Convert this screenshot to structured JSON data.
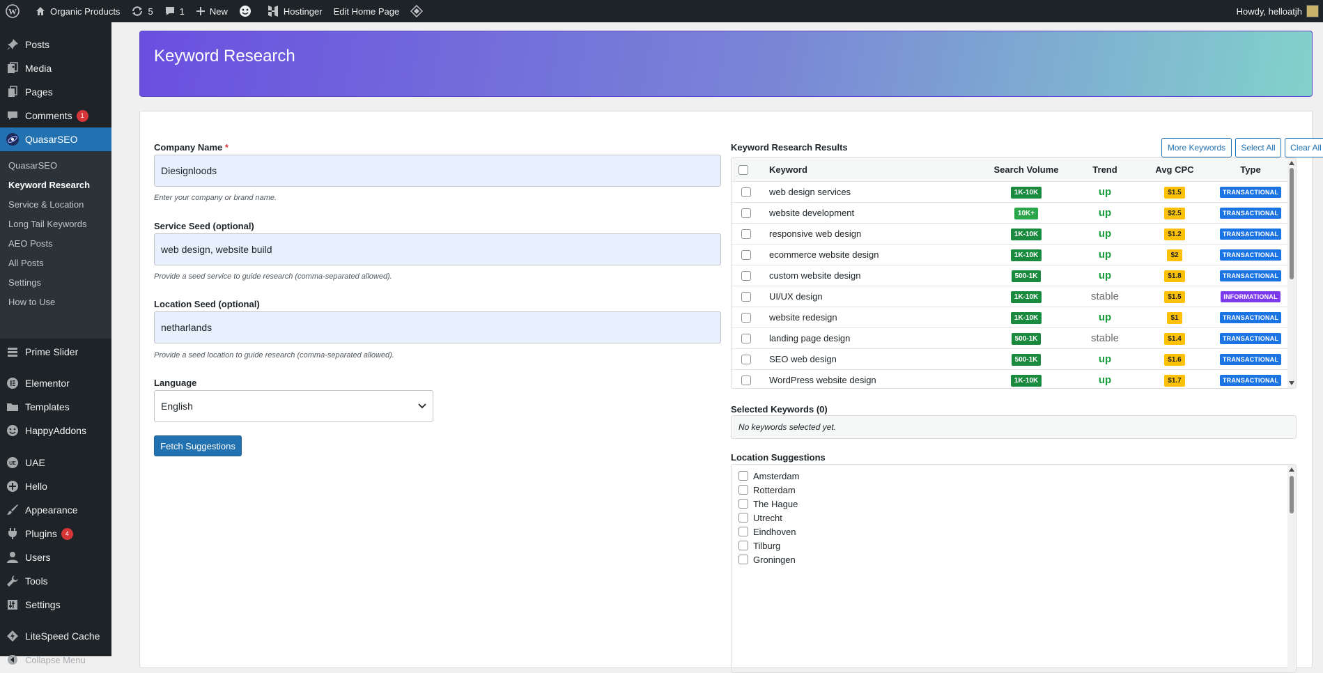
{
  "adminbar": {
    "site_name": "Organic Products",
    "updates_count": "5",
    "comments_count": "1",
    "new_label": "New",
    "hostinger_label": "Hostinger",
    "edit_label": "Edit Home Page",
    "howdy": "Howdy, helloatjh"
  },
  "sidebar": {
    "posts": "Posts",
    "media": "Media",
    "pages": "Pages",
    "comments": "Comments",
    "comments_badge": "1",
    "quasar": "QuasarSEO",
    "sub": [
      "QuasarSEO",
      "Keyword Research",
      "Service & Location",
      "Long Tail Keywords",
      "AEO Posts",
      "All Posts",
      "Settings",
      "How to Use"
    ],
    "prime_slider": "Prime Slider",
    "elementor": "Elementor",
    "templates": "Templates",
    "happyaddons": "HappyAddons",
    "uae": "UAE",
    "hello": "Hello",
    "appearance": "Appearance",
    "plugins": "Plugins",
    "plugins_badge": "4",
    "users": "Users",
    "tools": "Tools",
    "settings": "Settings",
    "litespeed": "LiteSpeed Cache",
    "collapse": "Collapse Menu"
  },
  "page": {
    "title": "Keyword Research"
  },
  "form": {
    "company_label": "Company Name",
    "company_required": "*",
    "company_value": "Diesignloods",
    "company_help": "Enter your company or brand name.",
    "service_label": "Service Seed (optional)",
    "service_value": "web design, website build",
    "service_help": "Provide a seed service to guide research (comma-separated allowed).",
    "location_label": "Location Seed (optional)",
    "location_value": "netharlands",
    "location_help": "Provide a seed location to guide research (comma-separated allowed).",
    "language_label": "Language",
    "language_value": "English",
    "fetch_button": "Fetch Suggestions"
  },
  "results": {
    "title": "Keyword Research Results",
    "more_button": "More Keywords",
    "select_all_button": "Select All",
    "clear_all_button": "Clear All",
    "headers": [
      "Keyword",
      "Search Volume",
      "Trend",
      "Avg CPC",
      "Type"
    ],
    "rows": [
      {
        "keyword": "web design services",
        "volume": "1K-10K",
        "trend": "up",
        "cpc": "$1.5",
        "type": "TRANSACTIONAL"
      },
      {
        "keyword": "website development",
        "volume": "10K+",
        "trend": "up",
        "cpc": "$2.5",
        "type": "TRANSACTIONAL"
      },
      {
        "keyword": "responsive web design",
        "volume": "1K-10K",
        "trend": "up",
        "cpc": "$1.2",
        "type": "TRANSACTIONAL"
      },
      {
        "keyword": "ecommerce website design",
        "volume": "1K-10K",
        "trend": "up",
        "cpc": "$2",
        "type": "TRANSACTIONAL"
      },
      {
        "keyword": "custom website design",
        "volume": "500-1K",
        "trend": "up",
        "cpc": "$1.8",
        "type": "TRANSACTIONAL"
      },
      {
        "keyword": "UI/UX design",
        "volume": "1K-10K",
        "trend": "stable",
        "cpc": "$1.5",
        "type": "INFORMATIONAL"
      },
      {
        "keyword": "website redesign",
        "volume": "1K-10K",
        "trend": "up",
        "cpc": "$1",
        "type": "TRANSACTIONAL"
      },
      {
        "keyword": "landing page design",
        "volume": "500-1K",
        "trend": "stable",
        "cpc": "$1.4",
        "type": "TRANSACTIONAL"
      },
      {
        "keyword": "SEO web design",
        "volume": "500-1K",
        "trend": "up",
        "cpc": "$1.6",
        "type": "TRANSACTIONAL"
      },
      {
        "keyword": "WordPress website design",
        "volume": "1K-10K",
        "trend": "up",
        "cpc": "$1.7",
        "type": "TRANSACTIONAL"
      }
    ]
  },
  "selected": {
    "title": "Selected Keywords (0)",
    "empty": "No keywords selected yet."
  },
  "locations": {
    "title": "Location Suggestions",
    "items": [
      "Amsterdam",
      "Rotterdam",
      "The Hague",
      "Utrecht",
      "Eindhoven",
      "Tilburg",
      "Groningen"
    ]
  }
}
